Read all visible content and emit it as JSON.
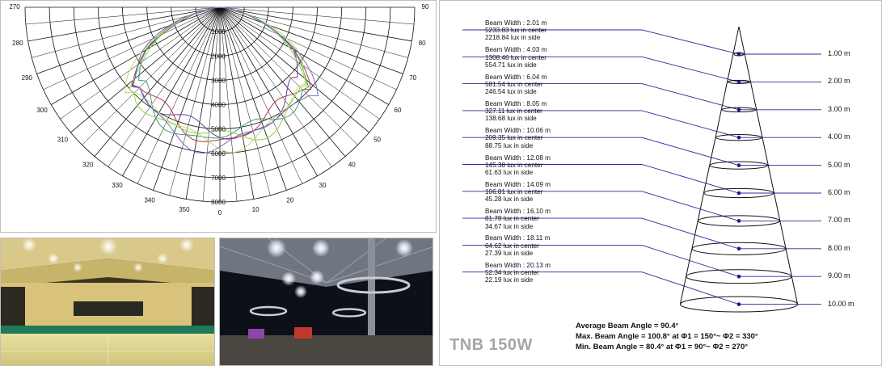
{
  "polar": {
    "radial_labels": [
      "1000",
      "2000",
      "3000",
      "4000",
      "5000",
      "6000",
      "7000",
      "8000"
    ],
    "angle_labels": [
      {
        "deg": 90,
        "text": "90"
      },
      {
        "deg": 80,
        "text": "80"
      },
      {
        "deg": 70,
        "text": "70"
      },
      {
        "deg": 60,
        "text": "60"
      },
      {
        "deg": 50,
        "text": "50"
      },
      {
        "deg": 40,
        "text": "40"
      },
      {
        "deg": 30,
        "text": "30"
      },
      {
        "deg": 20,
        "text": "20"
      },
      {
        "deg": 10,
        "text": "10"
      },
      {
        "deg": 0,
        "text": "0"
      },
      {
        "deg": -10,
        "text": "350"
      },
      {
        "deg": -20,
        "text": "340"
      },
      {
        "deg": -30,
        "text": "330"
      },
      {
        "deg": -40,
        "text": "320"
      },
      {
        "deg": -50,
        "text": "310"
      },
      {
        "deg": -60,
        "text": "300"
      },
      {
        "deg": -70,
        "text": "290"
      },
      {
        "deg": -80,
        "text": "280"
      },
      {
        "deg": -90,
        "text": "270"
      }
    ],
    "curve_colors": [
      "#6a3d9a",
      "#b23a48",
      "#3f9f6f",
      "#8fd14f",
      "#b8e06a",
      "#7b68c8"
    ]
  },
  "beam_levels": [
    {
      "width": "Beam Width : 2.01 m",
      "center": "5233.83 lux in center",
      "side": "2218.84 lux in side",
      "distance": "1.00 m"
    },
    {
      "width": "Beam Width : 4.03 m",
      "center": "1308.46 lux in center",
      "side": "554.71 lux in side",
      "distance": "2.00 m"
    },
    {
      "width": "Beam Width : 6.04 m",
      "center": "581.54 lux in center",
      "side": "246.54 lux in side",
      "distance": "3.00 m"
    },
    {
      "width": "Beam Width : 8.05 m",
      "center": "327.11 lux in center",
      "side": "138.68 lux in side",
      "distance": "4.00 m"
    },
    {
      "width": "Beam Width : 10.06 m",
      "center": "209.35 lux in center",
      "side": "88.75 lux in side",
      "distance": "5.00 m"
    },
    {
      "width": "Beam Width : 12.08 m",
      "center": "145.38 lux in center",
      "side": "61.63 lux in side",
      "distance": "6.00 m"
    },
    {
      "width": "Beam Width : 14.09 m",
      "center": "106.81 lux in center",
      "side": "45.28 lux in side",
      "distance": "7.00 m"
    },
    {
      "width": "Beam Width : 16.10 m",
      "center": "81.78 lux in center",
      "side": "34.67 lux in side",
      "distance": "8.00 m"
    },
    {
      "width": "Beam Width : 18.11 m",
      "center": "64.62 lux in center",
      "side": "27.39 lux in side",
      "distance": "9.00 m"
    },
    {
      "width": "Beam Width : 20.13 m",
      "center": "52.34 lux in center",
      "side": "22.19 lux in side",
      "distance": "10.00 m"
    }
  ],
  "stats": {
    "average": "Average Beam Angle = 90.4°",
    "max": "Max. Beam Angle = 100.8° at Φ1 = 150°~ Φ2 = 330°",
    "min": "Min. Beam Angle = 80.4° at Φ1 = 90°~ Φ2 = 270°"
  },
  "product": {
    "name": "TNB 150W"
  },
  "colors": {
    "leader_line": "#2b2b9e",
    "product_gray": "#a6a6a6"
  }
}
